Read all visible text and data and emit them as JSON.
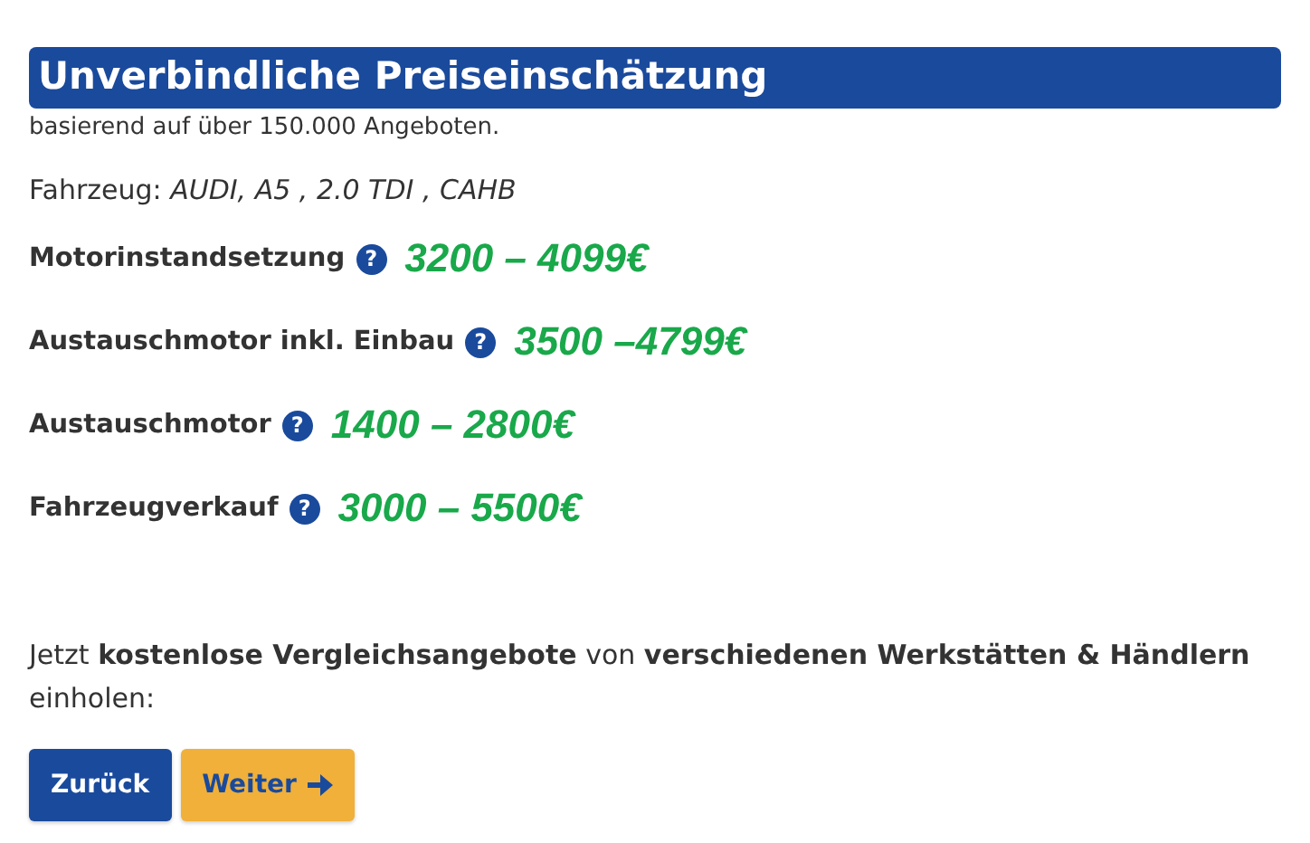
{
  "heading": "Unverbindliche Preiseinschätzung",
  "subtitle": "basierend auf über 150.000 Angeboten.",
  "vehicle": "Fahrzeug: *AUDI, A5 , 2.0 TDI , CAHB*",
  "estimates": [
    {
      "label": "Motorinstandsetzung",
      "help": "?",
      "price": "3200 – 4099€"
    },
    {
      "label": "Austauschmotor inkl. Einbau",
      "help": "?",
      "price": "3500 –4799€"
    },
    {
      "label": "Austauschmotor",
      "help": "?",
      "price": "1400 – 2800€"
    },
    {
      "label": "Fahrzeugverkauf",
      "help": "?",
      "price": "3000 – 5500€"
    }
  ],
  "call_to_action": "Jetzt **kostenlose Vergleichsangebote** von **verschiedenen Werkstätten & Händlern** einholen:",
  "buttons": [
    {
      "kind": "back",
      "label": "Zurück"
    },
    {
      "kind": "next",
      "label": "Weiter"
    }
  ]
}
